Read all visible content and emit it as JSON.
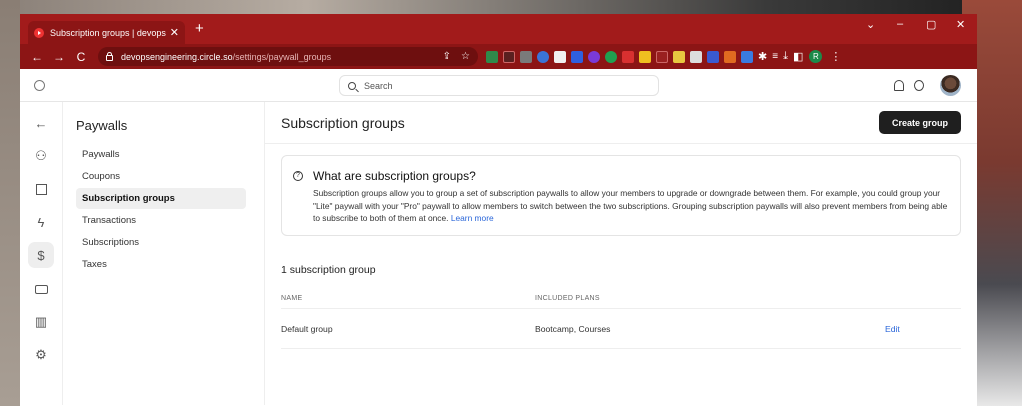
{
  "browser": {
    "tab_title": "Subscription groups | devopseng",
    "new_tab": "+",
    "url_host": "devopsengineering.circle.so",
    "url_path": "/settings/paywall_groups",
    "profile_initial": "R",
    "window_controls": [
      "minimize",
      "maximize",
      "close"
    ]
  },
  "header": {
    "search_placeholder": "Search"
  },
  "rail": {
    "icons": [
      "back-arrow-icon",
      "members-icon",
      "document-icon",
      "bolt-icon",
      "dollar-icon",
      "card-icon",
      "analytics-icon",
      "settings-icon"
    ]
  },
  "sidebar": {
    "title": "Paywalls",
    "items": [
      {
        "label": "Paywalls"
      },
      {
        "label": "Coupons"
      },
      {
        "label": "Subscription groups",
        "active": true
      },
      {
        "label": "Transactions"
      },
      {
        "label": "Subscriptions"
      },
      {
        "label": "Taxes"
      }
    ]
  },
  "main": {
    "title": "Subscription groups",
    "create_button": "Create group",
    "info": {
      "heading": "What are subscription groups?",
      "body": "Subscription groups allow you to group a set of subscription paywalls to allow your members to upgrade or downgrade between them. For example, you could group your \"Lite\" paywall with your \"Pro\" paywall to allow members to switch between the two subscriptions. Grouping subscription paywalls will also prevent members from being able to subscribe to both of them at once.",
      "link": "Learn more"
    },
    "count_label": "1 subscription group",
    "table": {
      "headers": [
        "NAME",
        "INCLUDED PLANS",
        ""
      ],
      "rows": [
        {
          "name": "Default group",
          "plans": "Bootcamp, Courses",
          "action": "Edit"
        }
      ]
    }
  },
  "colors": {
    "browser_frame": "#a21b1b",
    "toolbar": "#8c1515",
    "primary_button": "#1f1f1f",
    "link": "#2a66d9"
  }
}
